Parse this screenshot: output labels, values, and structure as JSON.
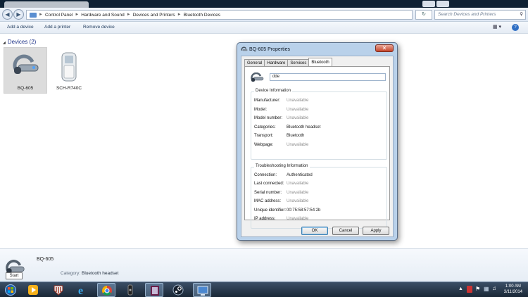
{
  "window": {
    "breadcrumbs": [
      "Control Panel",
      "Hardware and Sound",
      "Devices and Printers",
      "Bluetooth Devices"
    ],
    "search_placeholder": "Search Devices and Printers",
    "toolbar": {
      "add_device": "Add a device",
      "add_printer": "Add a printer",
      "remove_device": "Remove device"
    }
  },
  "devices_group": {
    "title": "Devices (2)"
  },
  "devices": [
    {
      "label": "BQ-605",
      "icon": "bluetooth-headset-icon",
      "selected": true
    },
    {
      "label": "SCH-R740C",
      "icon": "phone-icon",
      "selected": false
    }
  ],
  "details_pane": {
    "name": "BQ-605",
    "category_label": "Category:",
    "category_value": "Bluetooth headset",
    "start_tooltip": "Start"
  },
  "dialog": {
    "title": "BQ-605 Properties",
    "tabs": [
      "General",
      "Hardware",
      "Services",
      "Bluetooth"
    ],
    "active_tab": "Bluetooth",
    "name_value": "dde",
    "device_info": {
      "legend": "Device Information",
      "rows": [
        {
          "key": "Manufacturer:",
          "value": "Unavailable"
        },
        {
          "key": "Model:",
          "value": "Unavailable"
        },
        {
          "key": "Model number:",
          "value": "Unavailable"
        },
        {
          "key": "Categories:",
          "value": "Bluetooth headset"
        },
        {
          "key": "Transport:",
          "value": "Bluetooth"
        },
        {
          "key": "Webpage:",
          "value": "Unavailable"
        }
      ]
    },
    "troubleshooting": {
      "legend": "Troubleshooting Information",
      "rows": [
        {
          "key": "Connection:",
          "value": "Authenticated"
        },
        {
          "key": "Last connected:",
          "value": "Unavailable"
        },
        {
          "key": "Serial number:",
          "value": "Unavailable"
        },
        {
          "key": "MAC address:",
          "value": "Unavailable"
        },
        {
          "key": "Unique identifier:",
          "value": "00:75:58:57:54:2b"
        },
        {
          "key": "IP address:",
          "value": "Unavailable"
        }
      ]
    },
    "buttons": {
      "ok": "OK",
      "cancel": "Cancel",
      "apply": "Apply"
    }
  },
  "taskbar": {
    "items": [
      "start-orb-icon",
      "media-player-icon",
      "shield-app-icon",
      "internet-explorer-icon",
      "chrome-icon",
      "media-app-icon",
      "game-app-icon",
      "steam-icon",
      "remote-desktop-icon"
    ],
    "clock_time": "1:00 AM",
    "clock_date": "3/11/2014"
  }
}
